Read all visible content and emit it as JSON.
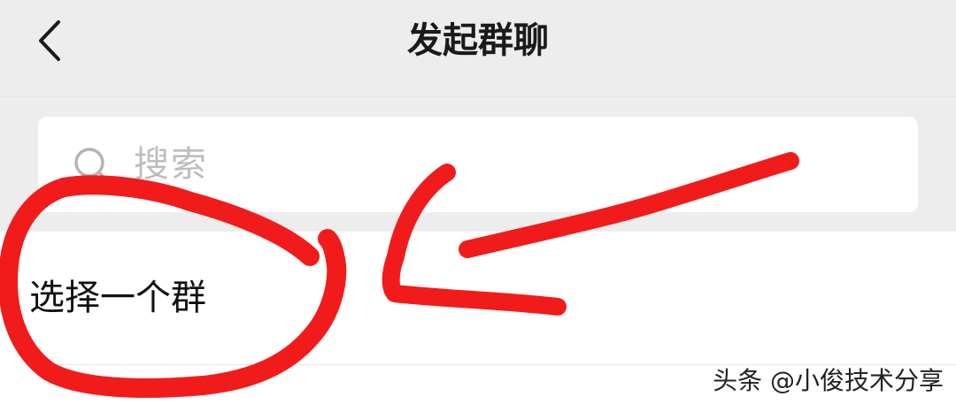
{
  "header": {
    "title": "发起群聊",
    "back_icon": "chevron-left-icon"
  },
  "search": {
    "placeholder": "搜索",
    "icon": "search-icon"
  },
  "list": {
    "select_group_label": "选择一个群"
  },
  "annotation": {
    "color": "#f21b1b"
  },
  "watermark": {
    "text": "头条 @小俊技术分享"
  }
}
